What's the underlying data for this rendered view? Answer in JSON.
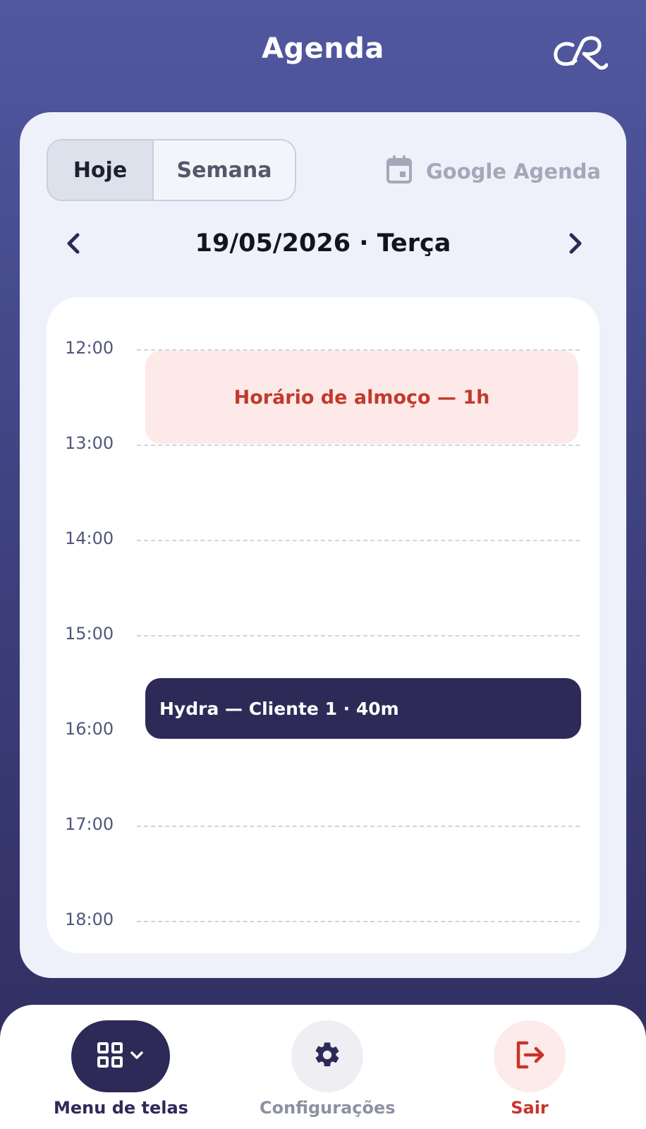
{
  "header": {
    "title": "Agenda"
  },
  "view_toggle": {
    "today_label": "Hoje",
    "week_label": "Semana",
    "active": "Hoje"
  },
  "google": {
    "label": "Google Agenda"
  },
  "date_nav": {
    "date_label": "19/05/2026 · Terça"
  },
  "timeline": {
    "hours": [
      "12:00",
      "13:00",
      "14:00",
      "15:00",
      "16:00",
      "17:00",
      "18:00"
    ],
    "events": {
      "lunch": "Horário de almoço — 1h",
      "client": "Hydra — Cliente 1 · 40m"
    }
  },
  "bottom_nav": {
    "menu_label": "Menu de telas",
    "settings_label": "Configurações",
    "logout_label": "Sair"
  },
  "colors": {
    "accent_dark": "#2d2a57",
    "lunch_bg": "#fde9e8",
    "lunch_text": "#c13a2c",
    "logout": "#c8342c"
  },
  "icons": {
    "logo": "cr-logo-icon",
    "google": "calendar-icon",
    "prev": "chevron-left-icon",
    "next": "chevron-right-icon",
    "menu": "grid-icon",
    "settings": "gear-icon",
    "logout": "logout-icon"
  }
}
